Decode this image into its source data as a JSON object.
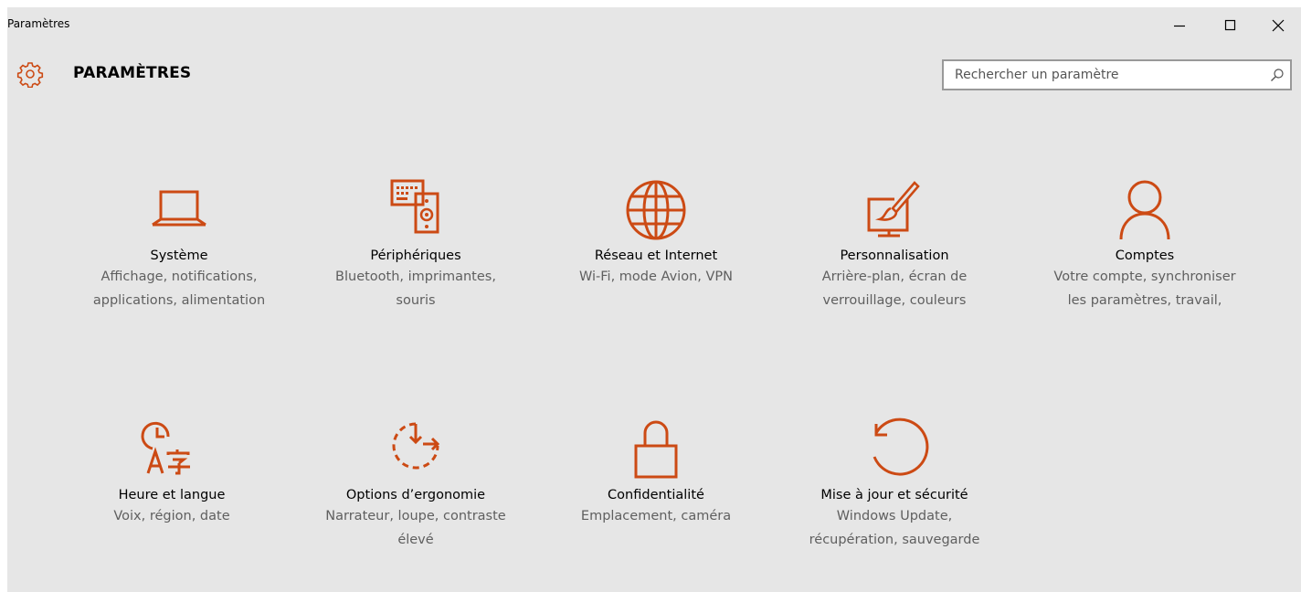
{
  "window": {
    "title": "Paramètres"
  },
  "header": {
    "title": "PARAMÈTRES",
    "icon": "gear-icon"
  },
  "search": {
    "placeholder": "Rechercher un paramètre",
    "value": ""
  },
  "colors": {
    "accent": "#cc4a14",
    "background": "#e6e6e6",
    "description_text": "#5f5f5f"
  },
  "categories": [
    {
      "name": "Système",
      "description": "Affichage, notifications, applications, alimentation",
      "icon": "laptop-icon"
    },
    {
      "name": "Périphériques",
      "description": "Bluetooth, imprimantes, souris",
      "icon": "devices-icon"
    },
    {
      "name": "Réseau et Internet",
      "description": "Wi-Fi, mode Avion, VPN",
      "icon": "globe-icon"
    },
    {
      "name": "Personnalisation",
      "description": "Arrière-plan, écran de verrouillage, couleurs",
      "icon": "paintbrush-icon"
    },
    {
      "name": "Comptes",
      "description": "Votre compte, synchroniser les paramètres, travail,",
      "icon": "person-icon"
    },
    {
      "name": "Heure et langue",
      "description": "Voix, région, date",
      "icon": "time-language-icon"
    },
    {
      "name": "Options d’ergonomie",
      "description": "Narrateur, loupe, contraste élevé",
      "icon": "ease-of-access-icon"
    },
    {
      "name": "Confidentialité",
      "description": "Emplacement, caméra",
      "icon": "lock-icon"
    },
    {
      "name": "Mise à jour et sécurité",
      "description": "Windows Update, récupération, sauvegarde",
      "icon": "update-icon"
    }
  ]
}
